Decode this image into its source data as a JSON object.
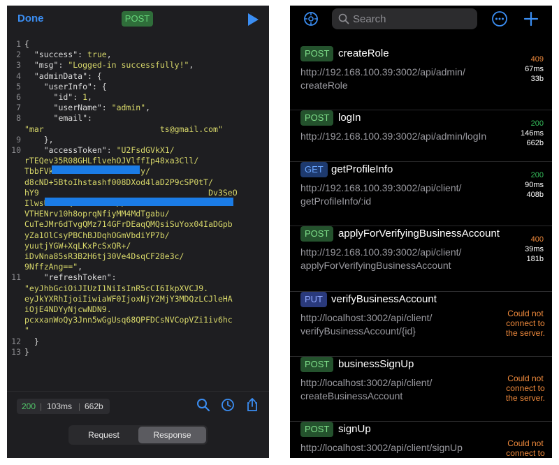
{
  "left": {
    "header": {
      "done_label": "Done",
      "method": "POST"
    },
    "lines": [
      {
        "n": "1",
        "parts": [
          [
            "p",
            "{"
          ]
        ]
      },
      {
        "n": "2",
        "parts": [
          [
            "k",
            "  \"success\""
          ],
          [
            "p",
            ": "
          ],
          [
            "s",
            "true"
          ],
          [
            "p",
            ","
          ]
        ]
      },
      {
        "n": "3",
        "parts": [
          [
            "k",
            "  \"msg\""
          ],
          [
            "p",
            ": "
          ],
          [
            "s",
            "\"Logged-in successfully!\""
          ],
          [
            "p",
            ","
          ]
        ]
      },
      {
        "n": "4",
        "parts": [
          [
            "k",
            "  \"adminData\""
          ],
          [
            "p",
            ": {"
          ]
        ]
      },
      {
        "n": "5",
        "parts": [
          [
            "k",
            "    \"userInfo\""
          ],
          [
            "p",
            ": {"
          ]
        ]
      },
      {
        "n": "6",
        "parts": [
          [
            "k",
            "      \"id\""
          ],
          [
            "p",
            ": "
          ],
          [
            "n",
            "1"
          ],
          [
            "p",
            ","
          ]
        ]
      },
      {
        "n": "7",
        "parts": [
          [
            "k",
            "      \"userName\""
          ],
          [
            "p",
            ": "
          ],
          [
            "s",
            "\"admin\""
          ],
          [
            "p",
            ","
          ]
        ]
      },
      {
        "n": "8",
        "parts": [
          [
            "k",
            "      \"email\""
          ],
          [
            "p",
            ":"
          ]
        ]
      },
      {
        "n": "",
        "parts": [
          [
            "s",
            "\"mar                        ts@gmail.com\""
          ]
        ]
      },
      {
        "n": "9",
        "parts": [
          [
            "p",
            "    },"
          ]
        ]
      },
      {
        "n": "10",
        "parts": [
          [
            "k",
            "    \"accessToken\""
          ],
          [
            "p",
            ": "
          ],
          [
            "s",
            "\"U2FsdGVkX1/"
          ]
        ]
      },
      {
        "n": "",
        "parts": [
          [
            "s",
            "rTEQev35R08GHLflvehOJVlffIp48xa3Cll/"
          ]
        ]
      },
      {
        "n": "",
        "parts": [
          [
            "s",
            "TbbFVkxdakCNCVU4SdJiAsc5y/"
          ]
        ]
      },
      {
        "n": "",
        "parts": [
          [
            "s",
            "d8cND+5BtoIhstashf008DXod4laD2P9cSP0tT/"
          ]
        ]
      },
      {
        "n": "",
        "parts": [
          [
            "s",
            "hY9                                   Dv3SeO"
          ]
        ]
      },
      {
        "n": "",
        "parts": [
          [
            "s",
            "IlwsUKYlzQn5Dk10UdH//"
          ]
        ]
      },
      {
        "n": "",
        "parts": [
          [
            "s",
            "VTHENrv10h8oprqNfiyMM4MdTgabu/"
          ]
        ]
      },
      {
        "n": "",
        "parts": [
          [
            "s",
            "CuTeJMr6dTvgQMz714GFrDEaqQMQsiSuYox04IaDGpb"
          ]
        ]
      },
      {
        "n": "",
        "parts": [
          [
            "s",
            "yZa1OlCsyPBChBJDqhOGmVbdiYP7b/"
          ]
        ]
      },
      {
        "n": "",
        "parts": [
          [
            "s",
            "yuutjYGW+XqLKxPcSxQR+/"
          ]
        ]
      },
      {
        "n": "",
        "parts": [
          [
            "s",
            "iDvNna85sR3B2H6tj30Ve4DsqCF28e3c/"
          ]
        ]
      },
      {
        "n": "",
        "parts": [
          [
            "s",
            "9NffzAng==\""
          ],
          [
            "p",
            ","
          ]
        ]
      },
      {
        "n": "11",
        "parts": [
          [
            "k",
            "    \"refreshToken\""
          ],
          [
            "p",
            ":"
          ]
        ]
      },
      {
        "n": "",
        "parts": [
          [
            "s",
            "\"eyJhbGciOiJIUzI1NiIsInR5cCI6IkpXVCJ9."
          ]
        ]
      },
      {
        "n": "",
        "parts": [
          [
            "s",
            "eyJkYXRhIjoiIiwiaWF0IjoxNjY2MjY3MDQzLCJleHA"
          ]
        ]
      },
      {
        "n": "",
        "parts": [
          [
            "s",
            "iOjE4NDYyNjcwNDN9."
          ]
        ]
      },
      {
        "n": "",
        "parts": [
          [
            "s",
            "pcxxanWoQy3Jnn5wGgUsq68QPFDCsNVCopVZi1iv6hc"
          ]
        ]
      },
      {
        "n": "",
        "parts": [
          [
            "s",
            "\""
          ]
        ]
      },
      {
        "n": "12",
        "parts": [
          [
            "p",
            "  }"
          ]
        ]
      },
      {
        "n": "13",
        "parts": [
          [
            "p",
            "}"
          ]
        ]
      }
    ],
    "footer": {
      "status": "200",
      "time": "103ms",
      "size": "662b",
      "seg_request": "Request",
      "seg_response": "Response"
    }
  },
  "right": {
    "search_placeholder": "Search",
    "requests": [
      {
        "method": "POST",
        "name": "createRole",
        "url": [
          "http://192.168.100.39:3002/api/admin/",
          "createRole"
        ],
        "status": "409",
        "time": "67ms",
        "size": "33b"
      },
      {
        "method": "POST",
        "name": "logIn",
        "url": [
          "http://192.168.100.39:3002/api/admin/logIn"
        ],
        "status": "200",
        "time": "146ms",
        "size": "662b"
      },
      {
        "method": "GET",
        "name": "getProfileInfo",
        "url": [
          "http://192.168.100.39:3002/api/client/",
          "getProfileInfo/:id"
        ],
        "status": "200",
        "time": "90ms",
        "size": "408b"
      },
      {
        "method": "POST",
        "name": "applyForVerifyingBusinessAccount",
        "url": [
          "http://192.168.100.39:3002/api/client/",
          "applyForVerifyingBusinessAccount"
        ],
        "status": "400",
        "time": "39ms",
        "size": "181b"
      },
      {
        "method": "PUT",
        "name": "verifyBusinessAccount",
        "url": [
          "http://localhost:3002/api/client/",
          "verifyBusinessAccount/{id}"
        ],
        "error": [
          "Could not",
          "connect to",
          "the server."
        ]
      },
      {
        "method": "POST",
        "name": "businessSignUp",
        "url": [
          "http://localhost:3002/api/client/",
          "createBusinessAccount"
        ],
        "error": [
          "Could not",
          "connect to",
          "the server."
        ]
      },
      {
        "method": "POST",
        "name": "signUp",
        "url": [
          "http://localhost:3002/api/client/signUp"
        ],
        "error": [
          "Could not",
          "connect to",
          "the server."
        ]
      }
    ]
  }
}
